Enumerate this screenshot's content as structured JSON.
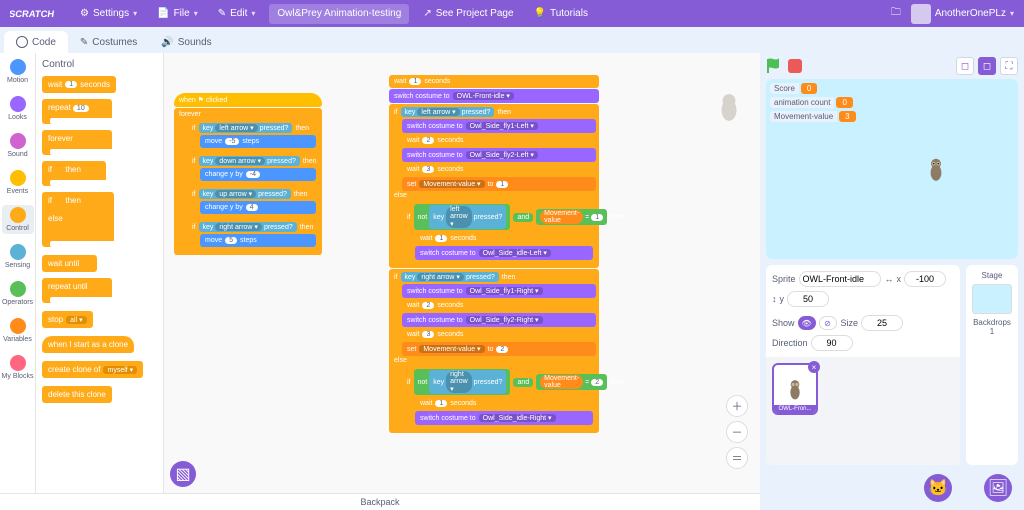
{
  "menu": {
    "settings": "Settings",
    "file": "File",
    "edit": "Edit",
    "project_title": "Owl&Prey Animation-testing",
    "see_project": "See Project Page",
    "tutorials": "Tutorials",
    "username": "AnotherOnePLz"
  },
  "tabs": {
    "code": "Code",
    "costumes": "Costumes",
    "sounds": "Sounds"
  },
  "categories": [
    {
      "name": "Motion",
      "color": "#4c97ff"
    },
    {
      "name": "Looks",
      "color": "#9966ff"
    },
    {
      "name": "Sound",
      "color": "#cf63cf"
    },
    {
      "name": "Events",
      "color": "#ffbf00"
    },
    {
      "name": "Control",
      "color": "#ffab19"
    },
    {
      "name": "Sensing",
      "color": "#5cb1d6"
    },
    {
      "name": "Operators",
      "color": "#59c059"
    },
    {
      "name": "Variables",
      "color": "#ff8c1a"
    },
    {
      "name": "My Blocks",
      "color": "#ff6680"
    }
  ],
  "palette_title": "Control",
  "palette": {
    "wait": "wait",
    "wait_val": "1",
    "seconds": "seconds",
    "repeat": "repeat",
    "repeat_val": "10",
    "forever": "forever",
    "if": "if",
    "then": "then",
    "if2": "if",
    "then2": "then",
    "else": "else",
    "wait_until": "wait until",
    "repeat_until": "repeat until",
    "stop": "stop",
    "stop_opt": "all ▾",
    "clone_hat": "when I start as a clone",
    "create_clone": "create clone of",
    "myself": "myself ▾",
    "delete_clone": "delete this clone"
  },
  "script1": {
    "event": "when ⚑ clicked",
    "forever": "forever",
    "if": "if",
    "then": "then",
    "key": "key",
    "pressed": "pressed?",
    "left": "left arrow ▾",
    "down": "down arrow ▾",
    "up": "up arrow ▾",
    "right": "right arrow ▾",
    "move": "move",
    "steps": "steps",
    "m5": "-5",
    "p5": "5",
    "changey": "change y by",
    "yneg": "-4",
    "ypos": "4"
  },
  "script2": {
    "wait": "wait",
    "sec": "seconds",
    "w1": "1",
    "w2": "2",
    "w3": "3",
    "switch": "switch costume to",
    "c_front": "OWL-Front-idle ▾",
    "c_fly1L": "Owl_Side_fly1-Left ▾",
    "c_fly2L": "Owl_Side_fly2-Left ▾",
    "c_idleL": "Owl_Side_idle-Left ▾",
    "c_fly1R": "Owl_Side_fly1-Right ▾",
    "c_fly2R": "Owl_Side_fly2-Right ▾",
    "c_idleR": "Owl_Side_idle-Right ▾",
    "if": "if",
    "then": "then",
    "else": "else",
    "key": "key",
    "pressed": "pressed?",
    "left": "left arrow ▾",
    "right": "right arrow ▾",
    "not": "not",
    "and": "and",
    "eq": "=",
    "set": "set",
    "to": "to",
    "mv": "Movement-value ▾",
    "mvpill": "Movement-value",
    "v1": "1",
    "v2": "2",
    "v3": "3"
  },
  "monitors": [
    {
      "label": "Score",
      "value": "0"
    },
    {
      "label": "animation count",
      "value": "0"
    },
    {
      "label": "Movement-value",
      "value": "3"
    }
  ],
  "sprite": {
    "label_sprite": "Sprite",
    "name": "OWL-Front-idle",
    "x_lbl": "x",
    "x": "-100",
    "y_lbl": "y",
    "y": "50",
    "show": "Show",
    "size_lbl": "Size",
    "size": "25",
    "dir_lbl": "Direction",
    "dir": "90",
    "tile": "OWL-Fron..."
  },
  "stage_side": {
    "title": "Stage",
    "backdrops": "Backdrops",
    "count": "1"
  },
  "backpack": "Backpack"
}
